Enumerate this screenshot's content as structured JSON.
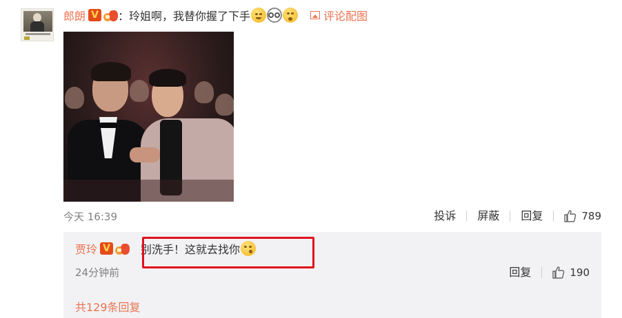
{
  "comment": {
    "username": "郎朗",
    "verified_badge": "V",
    "colon": "：",
    "text": "玲姐啊，我替你握了下手",
    "emojis": [
      "smile-emoji",
      "glasses-emoji",
      "shy-emoji"
    ],
    "comment_pic_link": "评论配图",
    "time": "今天 16:39",
    "actions": {
      "report": "投诉",
      "block": "屏蔽",
      "reply": "回复"
    },
    "like_count": "789"
  },
  "reply": {
    "username": "贾玲",
    "verified_badge": "V",
    "text": "别洗手！这就去找你",
    "emoji": "kiss-emoji",
    "time": "24分钟前",
    "reply_label": "回复",
    "like_count": "190",
    "more_replies": "共129条回复"
  },
  "colors": {
    "username": "#eb7350",
    "highlight_border": "#e0111b",
    "reply_background": "#f2f2f5",
    "time_text": "#808080"
  }
}
